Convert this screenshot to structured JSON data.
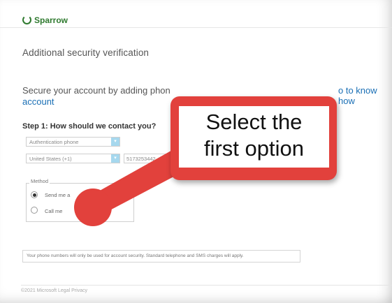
{
  "header": {
    "logo_text": "Sparrow"
  },
  "page": {
    "title": "Additional security verification",
    "intro_text": "Secure your account by adding phon",
    "intro_link_right": "o to know how",
    "intro_line2": "account"
  },
  "step1": {
    "title": "Step 1: How should we contact you?",
    "auth_select": "Authentication phone",
    "country_select": "United States (+1)",
    "phone_value": "5173253442",
    "method_legend": "Method",
    "options": [
      {
        "label": "Send me a",
        "checked": true
      },
      {
        "label": "Call me",
        "checked": false
      }
    ]
  },
  "notice": "Your phone numbers will only be used for account security. Standard telephone and SMS charges will apply.",
  "footer": "©2021 Microsoft   Legal   Privacy",
  "annotation": {
    "text_line1": "Select the",
    "text_line2": "first option",
    "color": "#e2413c"
  },
  "icons": {
    "logo": "sparrow-logo-icon",
    "dropdown": "chevron-down-icon"
  }
}
